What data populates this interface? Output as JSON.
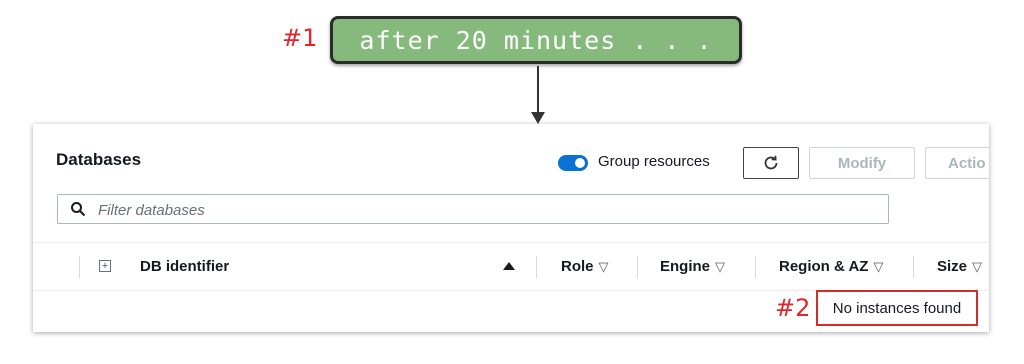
{
  "annotations": {
    "step1": "#1",
    "step2": "#2",
    "banner_text": "after 20 minutes . . ."
  },
  "databases": {
    "title": "Databases",
    "group_resources_label": "Group resources",
    "group_resources_enabled": true,
    "modify_label": "Modify",
    "actions_label": "Actio",
    "filter_placeholder": "Filter databases",
    "columns": [
      "DB identifier",
      "Role",
      "Engine",
      "Region & AZ",
      "Size"
    ],
    "empty_message": "No instances found"
  },
  "colors": {
    "annotation_red": "#e0252b",
    "banner_green": "#86ba7c",
    "toggle_blue": "#0972d3"
  }
}
